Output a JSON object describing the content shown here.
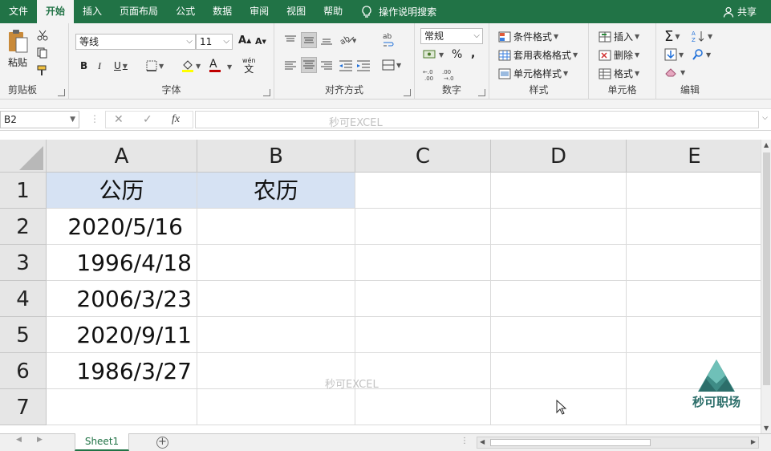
{
  "menu": {
    "tabs": [
      "文件",
      "开始",
      "插入",
      "页面布局",
      "公式",
      "数据",
      "审阅",
      "视图",
      "帮助"
    ],
    "active_tab": "开始",
    "tell_me": "操作说明搜索",
    "share": "共享"
  },
  "ribbon": {
    "clipboard": {
      "label": "剪贴板",
      "paste": "粘贴"
    },
    "font": {
      "label": "字体",
      "name": "等线",
      "size": "11",
      "bold": "B",
      "italic": "I",
      "underline": "U",
      "grow": "A",
      "shrink": "A",
      "color_char": "A",
      "phonetic_top": "wén",
      "phonetic_char": "文"
    },
    "alignment": {
      "label": "对齐方式"
    },
    "number": {
      "label": "数字",
      "format": "常规",
      "percent": "%",
      "comma": ","
    },
    "styles": {
      "label": "样式",
      "conditional": "条件格式",
      "table": "套用表格格式",
      "cell_styles": "单元格样式"
    },
    "cells": {
      "label": "单元格",
      "insert": "插入",
      "delete": "删除",
      "format": "格式"
    },
    "editing": {
      "label": "编辑"
    }
  },
  "formula_bar": {
    "name_box": "B2",
    "fx": "fx",
    "cancel": "✕",
    "enter": "✓",
    "watermark": "秒可EXCEL"
  },
  "grid": {
    "columns": [
      "A",
      "B",
      "C",
      "D",
      "E"
    ],
    "rows": [
      "1",
      "2",
      "3",
      "4",
      "5",
      "6",
      "7"
    ],
    "cells": {
      "A1": "公历",
      "B1": "农历",
      "A2": "2020/5/16",
      "A3": "1996/4/18",
      "A4": "2006/3/23",
      "A5": "2020/9/11",
      "A6": "1986/3/27"
    },
    "watermark": "秒可EXCEL"
  },
  "sheets": {
    "tabs": [
      "Sheet1"
    ],
    "active": "Sheet1",
    "add": "+"
  },
  "logo": {
    "text": "秒可职场"
  },
  "colors": {
    "excel_green": "#217346",
    "header_highlight": "#d6e2f3"
  }
}
